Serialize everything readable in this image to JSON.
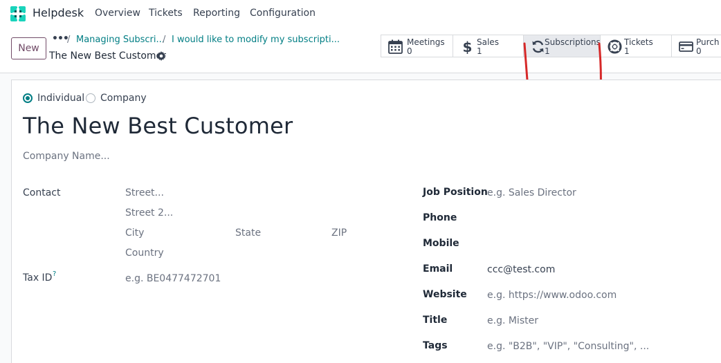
{
  "app": {
    "name": "Helpdesk"
  },
  "menu": [
    "Overview",
    "Tickets",
    "Reporting",
    "Configuration"
  ],
  "control": {
    "new_label": "New",
    "breadcrumb_dots": "•••",
    "breadcrumb": [
      "Managing Subscri...",
      "I would like to modify my subscripti..."
    ],
    "record_title": "The New Best Customer"
  },
  "smart_buttons": [
    {
      "label": "Meetings",
      "value": "0",
      "icon": "calendar-icon"
    },
    {
      "label": "Sales",
      "value": "1",
      "icon": "dollar-icon"
    },
    {
      "label": "Subscriptions",
      "value": "1",
      "icon": "refresh-icon"
    },
    {
      "label": "Tickets",
      "value": "1",
      "icon": "lifebuoy-icon"
    },
    {
      "label": "Purch",
      "value": "0",
      "icon": "credit-card-icon"
    }
  ],
  "form": {
    "type_options": [
      "Individual",
      "Company"
    ],
    "selected_type": "Individual",
    "name": "The New Best Customer",
    "company_placeholder": "Company Name...",
    "contact_label": "Contact",
    "address": {
      "street": "Street...",
      "street2": "Street 2...",
      "city": "City",
      "state": "State",
      "zip": "ZIP",
      "country": "Country"
    },
    "tax_id_label": "Tax ID",
    "tax_id_help": "?",
    "tax_id_placeholder": "e.g. BE0477472701",
    "right_fields": [
      {
        "label": "Job Position",
        "value": "e.g. Sales Director",
        "is_placeholder": true
      },
      {
        "label": "Phone",
        "value": ""
      },
      {
        "label": "Mobile",
        "value": ""
      },
      {
        "label": "Email",
        "value": "ccc@test.com",
        "is_placeholder": false
      },
      {
        "label": "Website",
        "value": "e.g. https://www.odoo.com",
        "is_placeholder": true
      },
      {
        "label": "Title",
        "value": "e.g. Mister",
        "is_placeholder": true
      },
      {
        "label": "Tags",
        "value": "e.g. \"B2B\", \"VIP\", \"Consulting\", ...",
        "is_placeholder": true
      }
    ]
  },
  "colors": {
    "brand": "#714b67",
    "accent": "#017e84",
    "annotation": "#d62828"
  }
}
